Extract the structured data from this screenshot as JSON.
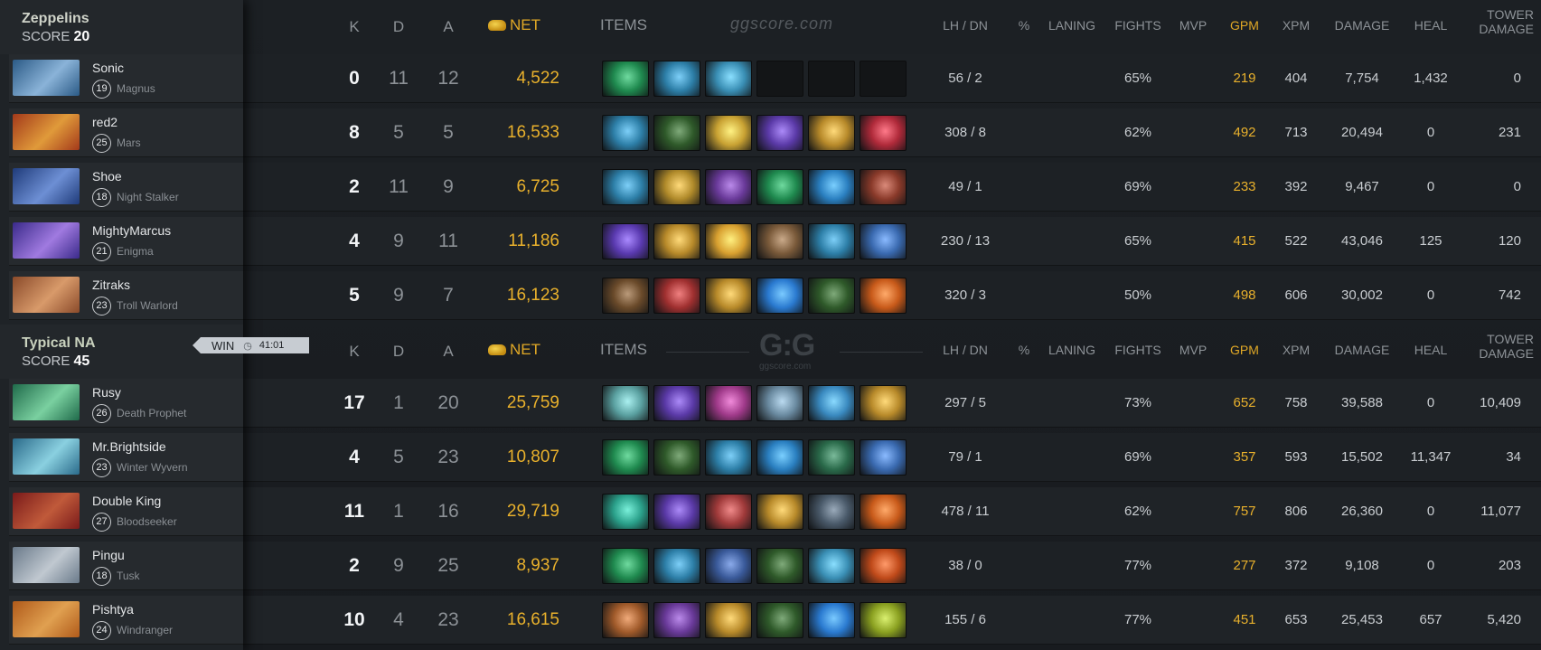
{
  "header_labels": {
    "k": "K",
    "d": "D",
    "a": "A",
    "net": "NET",
    "items": "ITEMS",
    "lh_dn": "LH  /  DN",
    "pct": "%",
    "laning": "LANING",
    "fights": "FIGHTS",
    "mvp": "MVP",
    "gpm": "GPM",
    "xpm": "XPM",
    "damage": "DAMAGE",
    "heal": "HEAL",
    "tower_damage_1": "TOWER",
    "tower_damage_2": "DAMAGE"
  },
  "watermark_text": "ggscore.com",
  "watermark_logo": "G:G",
  "score_label": "SCORE",
  "teams": [
    {
      "name": "Zeppelins",
      "score": "20",
      "players": [
        {
          "name": "Sonic",
          "level": "19",
          "hero": "Magnus",
          "k": "0",
          "d": "11",
          "a": "12",
          "net": "4,522",
          "lh_dn": "56  /  2",
          "fights": "65%",
          "gpm": "219",
          "xpm": "404",
          "damage": "7,754",
          "heal": "1,432",
          "tower": "0",
          "portrait": [
            "#2b5a86",
            "#8ab3d8"
          ],
          "items": [
            "#1f8a4f",
            "#2d7fa8",
            "#3a8fb5",
            "",
            "",
            ""
          ]
        },
        {
          "name": "red2",
          "level": "25",
          "hero": "Mars",
          "k": "8",
          "d": "5",
          "a": "5",
          "net": "16,533",
          "lh_dn": "308  /  8",
          "fights": "62%",
          "gpm": "492",
          "xpm": "713",
          "damage": "20,494",
          "heal": "0",
          "tower": "231",
          "portrait": [
            "#a3391a",
            "#e09a3a"
          ],
          "items": [
            "#2d7fa8",
            "#2f5a2a",
            "#c9a233",
            "#5b3aa8",
            "#b88a2a",
            "#b02a3a"
          ]
        },
        {
          "name": "Shoe",
          "level": "18",
          "hero": "Night Stalker",
          "k": "2",
          "d": "11",
          "a": "9",
          "net": "6,725",
          "lh_dn": "49  /  1",
          "fights": "69%",
          "gpm": "233",
          "xpm": "392",
          "damage": "9,467",
          "heal": "0",
          "tower": "0",
          "portrait": [
            "#1f3b7a",
            "#6d8fd4"
          ],
          "items": [
            "#2d7fa8",
            "#b08a2a",
            "#6a3a9a",
            "#1f8a4f",
            "#2a7fc0",
            "#8a3a2a"
          ]
        },
        {
          "name": "MightyMarcus",
          "level": "21",
          "hero": "Enigma",
          "k": "4",
          "d": "9",
          "a": "11",
          "net": "11,186",
          "lh_dn": "230  /  13",
          "fights": "65%",
          "gpm": "415",
          "xpm": "522",
          "damage": "43,046",
          "heal": "125",
          "tower": "120",
          "portrait": [
            "#3a2a8a",
            "#a07ae0"
          ],
          "items": [
            "#5a3ab0",
            "#b88a2a",
            "#d8a030",
            "#7a5a3a",
            "#2d7fa8",
            "#3a6ab0"
          ]
        },
        {
          "name": "Zitraks",
          "level": "23",
          "hero": "Troll Warlord",
          "k": "5",
          "d": "9",
          "a": "7",
          "net": "16,123",
          "lh_dn": "320  /  3",
          "fights": "50%",
          "gpm": "498",
          "xpm": "606",
          "damage": "30,002",
          "heal": "0",
          "tower": "742",
          "portrait": [
            "#8a4a2a",
            "#d89a6a"
          ],
          "items": [
            "#6a4a2a",
            "#a03030",
            "#b88a2a",
            "#2a7ad0",
            "#2f5a2a",
            "#c85a1a"
          ]
        }
      ]
    },
    {
      "name": "Typical NA",
      "score": "45",
      "result": "WIN",
      "duration": "41:01",
      "players": [
        {
          "name": "Rusy",
          "level": "26",
          "hero": "Death Prophet",
          "k": "17",
          "d": "1",
          "a": "20",
          "net": "25,759",
          "lh_dn": "297  /  5",
          "fights": "73%",
          "gpm": "652",
          "xpm": "758",
          "damage": "39,588",
          "heal": "0",
          "tower": "10,409",
          "portrait": [
            "#1f6a4a",
            "#7ad0a0"
          ],
          "items": [
            "#5aa0a0",
            "#5b3aa8",
            "#a03a8a",
            "#6a8aa0",
            "#3a8ac0",
            "#b88a2a"
          ]
        },
        {
          "name": "Mr.Brightside",
          "level": "23",
          "hero": "Winter Wyvern",
          "k": "4",
          "d": "5",
          "a": "23",
          "net": "10,807",
          "lh_dn": "79  /  1",
          "fights": "69%",
          "gpm": "357",
          "xpm": "593",
          "damage": "15,502",
          "heal": "11,347",
          "tower": "34",
          "portrait": [
            "#2a6a8a",
            "#8ad0e0"
          ],
          "items": [
            "#1f8a4f",
            "#2f5a2a",
            "#2d7fa8",
            "#2a7fc0",
            "#2a6a4a",
            "#3a6ab0"
          ]
        },
        {
          "name": "Double King",
          "level": "27",
          "hero": "Bloodseeker",
          "k": "11",
          "d": "1",
          "a": "16",
          "net": "29,719",
          "lh_dn": "478  /  11",
          "fights": "62%",
          "gpm": "757",
          "xpm": "806",
          "damage": "26,360",
          "heal": "0",
          "tower": "11,077",
          "portrait": [
            "#7a1a1a",
            "#c05a3a"
          ],
          "items": [
            "#2aa08a",
            "#5b3aa8",
            "#a03a3a",
            "#b88a2a",
            "#4a5a6a",
            "#c85a1a"
          ]
        },
        {
          "name": "Pingu",
          "level": "18",
          "hero": "Tusk",
          "k": "2",
          "d": "9",
          "a": "25",
          "net": "8,937",
          "lh_dn": "38  /  0",
          "fights": "77%",
          "gpm": "277",
          "xpm": "372",
          "damage": "9,108",
          "heal": "0",
          "tower": "203",
          "portrait": [
            "#6a7a8a",
            "#c0c8d0"
          ],
          "items": [
            "#1f8a4f",
            "#2d7fa8",
            "#3a5a9a",
            "#2f5a2a",
            "#3a8fb5",
            "#c04a1a"
          ]
        },
        {
          "name": "Pishtya",
          "level": "24",
          "hero": "Windranger",
          "k": "10",
          "d": "4",
          "a": "23",
          "net": "16,615",
          "lh_dn": "155  /  6",
          "fights": "77%",
          "gpm": "451",
          "xpm": "653",
          "damage": "25,453",
          "heal": "657",
          "tower": "5,420",
          "portrait": [
            "#b05a1a",
            "#e0a050"
          ],
          "items": [
            "#a05a2a",
            "#6a3a9a",
            "#b88a2a",
            "#2f5a2a",
            "#2a7ad0",
            "#8aa020"
          ]
        }
      ]
    }
  ]
}
